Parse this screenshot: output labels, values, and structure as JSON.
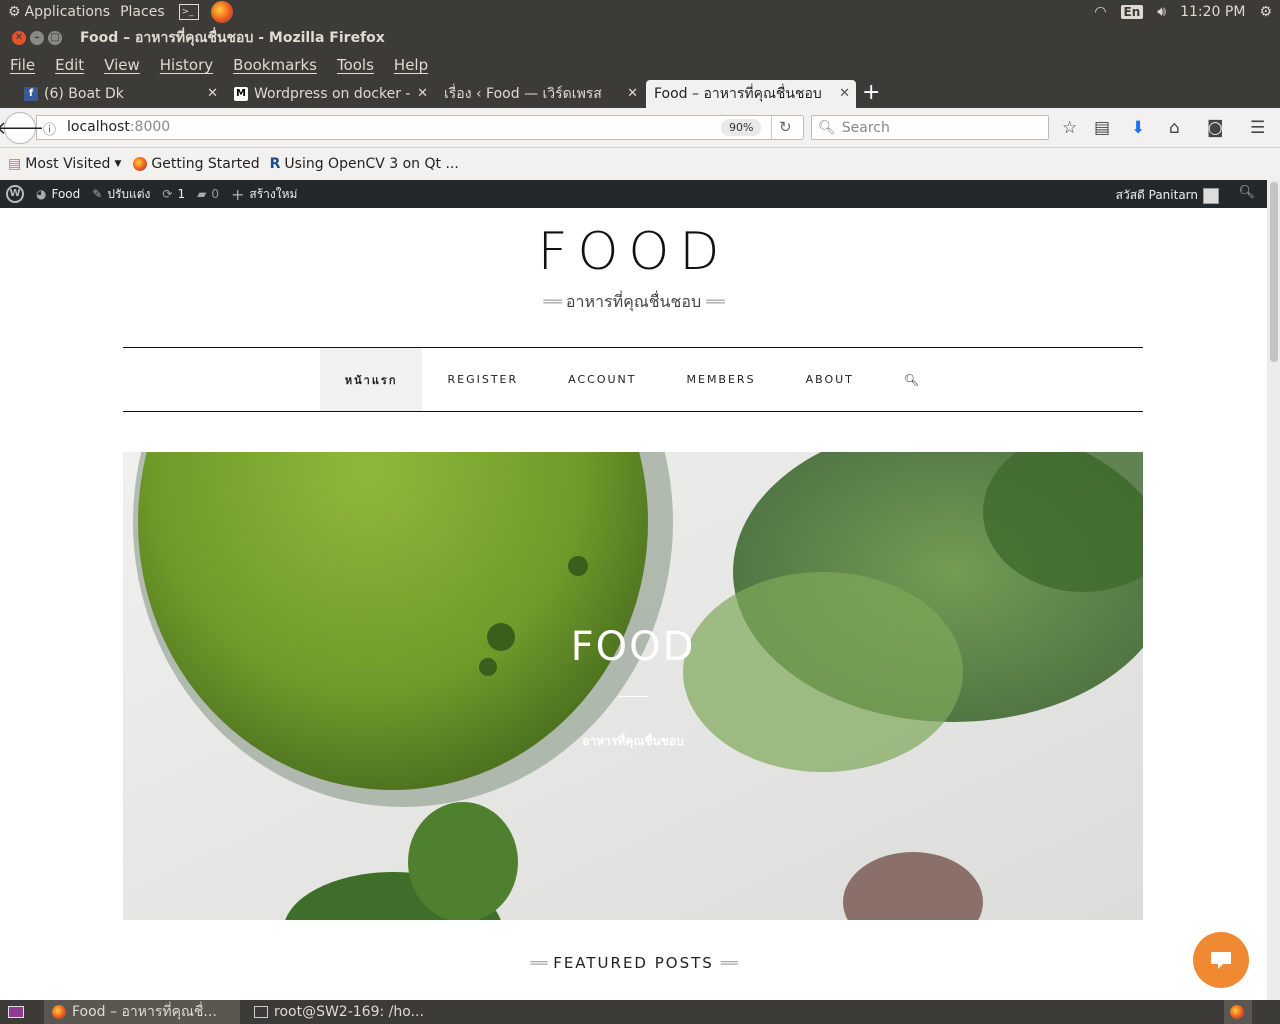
{
  "panel": {
    "applications": "Applications",
    "places": "Places",
    "lang": "En",
    "clock": "11:20 PM"
  },
  "window": {
    "title": "Food – อาหารที่คุณชื่นชอบ - Mozilla Firefox"
  },
  "menubar": {
    "items": [
      "File",
      "Edit",
      "View",
      "History",
      "Bookmarks",
      "Tools",
      "Help"
    ]
  },
  "tabs": [
    {
      "label": "(6) Boat Dk",
      "active": false
    },
    {
      "label": "Wordpress on docker -",
      "active": false
    },
    {
      "label": "เรื่อง ‹ Food — เวิร์ดเพรส",
      "active": false
    },
    {
      "label": "Food – อาหารที่คุณชื่นชอบ",
      "active": true
    }
  ],
  "navbar": {
    "url_host": "localhost",
    "url_port": ":8000",
    "zoom": "90%",
    "search_placeholder": "Search"
  },
  "bookmarks": {
    "items": [
      "Most Visited",
      "Getting Started",
      "Using OpenCV 3 on Qt ..."
    ]
  },
  "wpbar": {
    "site": "Food",
    "customize": "ปรับแต่ง",
    "updates": "1",
    "comments": "0",
    "new": "สร้างใหม่",
    "greeting": "สวัสดี Panitarn"
  },
  "site": {
    "title": "FOOD",
    "tagline": "อาหารที่คุณชื่นชอบ",
    "nav": [
      "หน้าแรก",
      "REGISTER",
      "ACCOUNT",
      "MEMBERS",
      "ABOUT"
    ],
    "hero_title": "FOOD",
    "hero_subtitle": "อาหารที่คุณชื่นชอบ",
    "featured": "FEATURED POSTS"
  },
  "taskbar": {
    "items": [
      "Food – อาหารที่คุณชื่...",
      "root@SW2-169: /ho..."
    ]
  },
  "colors": {
    "panel_bg": "#3c3b37",
    "wpbar_bg": "#23282d",
    "chat_accent": "#f08a32"
  }
}
